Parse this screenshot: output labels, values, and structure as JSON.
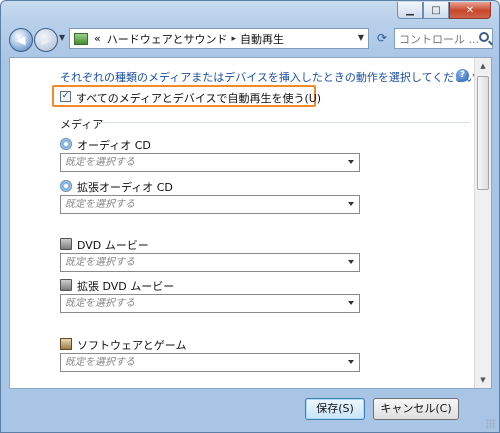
{
  "window": {
    "caption_buttons": {
      "minimize": "▁",
      "maximize": "□",
      "close": "✕"
    }
  },
  "nav": {
    "back_glyph": "◀",
    "forward_glyph": "▶",
    "breadcrumb_prefix": "«",
    "breadcrumb_parent": "ハードウェアとサウンド",
    "breadcrumb_separator": "▸",
    "breadcrumb_current": "自動再生",
    "search_placeholder": "コントロール ..."
  },
  "content": {
    "description": "それぞれの種類のメディアまたはデバイスを挿入したときの動作を選択してください",
    "autoplay_checkbox": {
      "label": "すべてのメディアとデバイスで自動再生を使う(U)",
      "checked": true,
      "mark": "✓"
    },
    "section_label": "メディア",
    "items": [
      {
        "label": "オーディオ CD",
        "icon": "audio-cd-icon",
        "value": "既定を選択する"
      },
      {
        "label": "拡張オーディオ CD",
        "icon": "audio-cd-icon",
        "value": "既定を選択する"
      },
      {
        "label": "DVD ムービー",
        "icon": "dvd-icon",
        "value": "既定を選択する"
      },
      {
        "label": "拡張 DVD ムービー",
        "icon": "dvd-icon",
        "value": "既定を選択する"
      },
      {
        "label": "ソフトウェアとゲーム",
        "icon": "software-game-icon",
        "value": "既定を選択する"
      }
    ]
  },
  "footer": {
    "save_label": "保存(S)",
    "cancel_label": "キャンセル(C)"
  },
  "colors": {
    "highlight_border": "#f28c28",
    "description_text": "#1a4fa0"
  }
}
